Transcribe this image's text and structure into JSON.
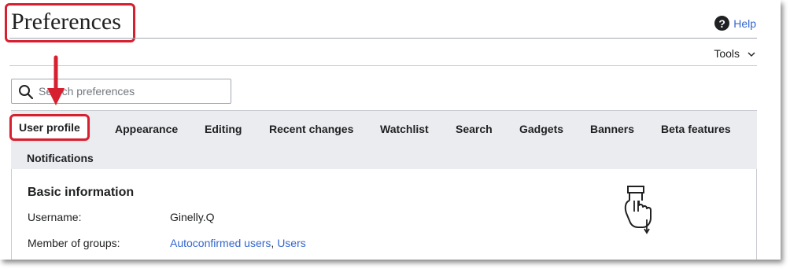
{
  "page": {
    "title": "Preferences",
    "help_label": "Help",
    "tools_label": "Tools"
  },
  "search": {
    "placeholder": "Search preferences"
  },
  "tabs": [
    {
      "label": "User profile",
      "active": true
    },
    {
      "label": "Appearance"
    },
    {
      "label": "Editing"
    },
    {
      "label": "Recent changes"
    },
    {
      "label": "Watchlist"
    },
    {
      "label": "Search"
    },
    {
      "label": "Gadgets"
    },
    {
      "label": "Banners"
    },
    {
      "label": "Beta features"
    },
    {
      "label": "Notifications"
    }
  ],
  "basic_info": {
    "heading": "Basic information",
    "username_label": "Username:",
    "username_value": "Ginelly.Q",
    "groups_label": "Member of groups:",
    "groups": [
      "Autoconfirmed users",
      "Users"
    ],
    "groups_separator": ", "
  },
  "icons": {
    "help": "question-circle-icon",
    "tools": "chevron-down-icon",
    "search": "search-icon",
    "scroll_hint": "hand-scroll-down-icon",
    "annotation": "red-arrow-down-icon"
  },
  "colors": {
    "annotation_red": "#d62030",
    "link_blue": "#3366cc",
    "tab_bar_bg": "#eaecf0"
  }
}
